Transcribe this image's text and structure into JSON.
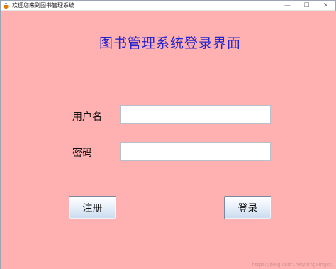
{
  "window": {
    "title": "欢迎您来到图书管理系统",
    "app_icon": "java-cup-icon",
    "controls": {
      "minimize": "—",
      "maximize": "☐",
      "close": "✕"
    }
  },
  "form": {
    "heading": "图书管理系统登录界面",
    "username_label": "用户名",
    "username_value": "",
    "password_label": "密码",
    "password_value": "",
    "register_button": "注册",
    "login_button": "登录"
  },
  "watermark": "https://blog.csdn.net/bingxingzc",
  "colors": {
    "background": "#ffb0b0",
    "heading": "#2424d0",
    "button_gradient_top": "#ffffff",
    "button_gradient_bottom": "#c9dbee"
  }
}
